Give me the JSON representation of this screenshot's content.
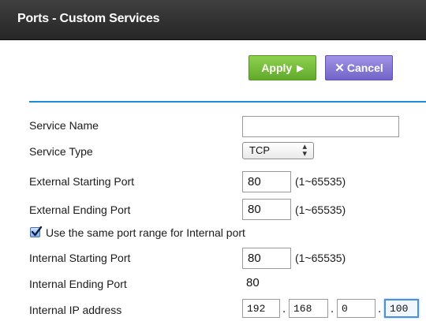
{
  "header": {
    "title": "Ports - Custom Services"
  },
  "toolbar": {
    "apply_label": "Apply",
    "cancel_label": "Cancel"
  },
  "form": {
    "service_name": {
      "label": "Service Name",
      "value": ""
    },
    "service_type": {
      "label": "Service Type",
      "value": "TCP"
    },
    "external_start": {
      "label": "External Starting Port",
      "value": "80",
      "hint": "(1~65535)"
    },
    "external_end": {
      "label": "External Ending Port",
      "value": "80",
      "hint": "(1~65535)"
    },
    "same_range": {
      "label": "Use the same port range for Internal port",
      "checked": true
    },
    "internal_start": {
      "label": "Internal Starting Port",
      "value": "80",
      "hint": "(1~65535)"
    },
    "internal_end": {
      "label": "Internal Ending Port",
      "value": "80"
    },
    "internal_ip": {
      "label": "Internal IP address",
      "octets": [
        "192",
        "168",
        "0",
        "100"
      ]
    }
  },
  "colors": {
    "accent_blue": "#1c8ad6",
    "apply_green": "#62a92b",
    "cancel_purple": "#7264c8",
    "titlebar": "#2f2f2f"
  }
}
